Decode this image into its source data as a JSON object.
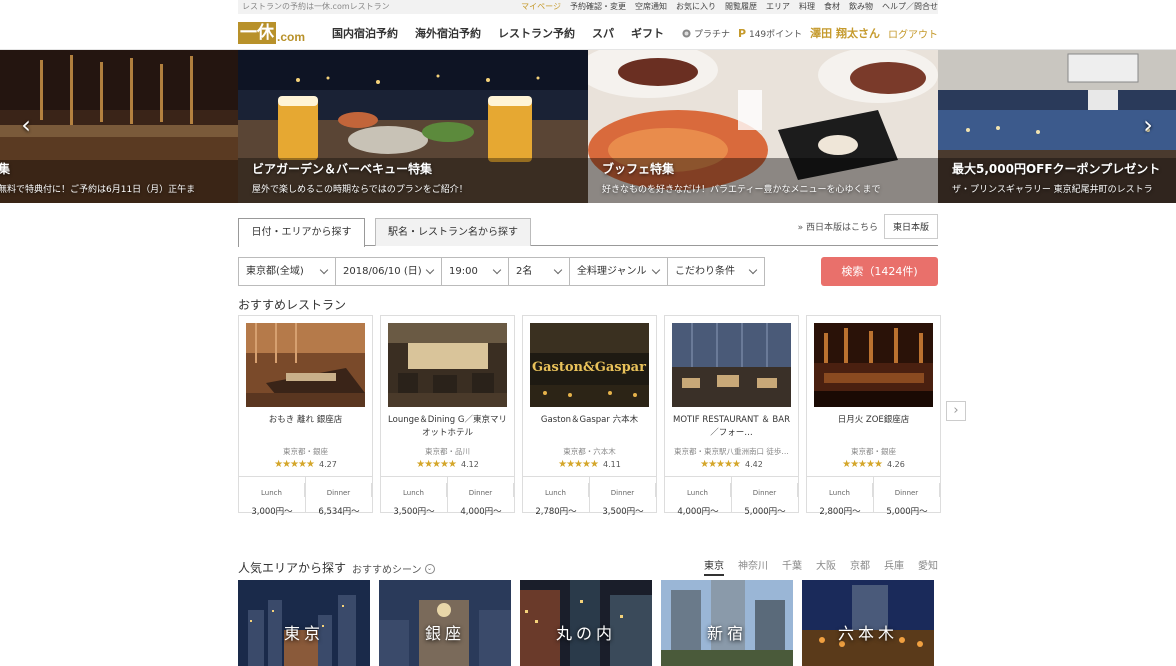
{
  "topbar": {
    "tagline": "レストランの予約は一休.comレストラン",
    "links": [
      "マイページ",
      "予約確認・変更",
      "空席通知",
      "お気に入り",
      "閲覧履歴",
      "エリア",
      "料理",
      "食材",
      "飲み物",
      "ヘルプ／問合せ"
    ]
  },
  "header": {
    "logo_mark": "一休",
    "logo_suffix": ".com",
    "nav": [
      "国内宿泊予約",
      "海外宿泊予約",
      "レストラン予約",
      "スパ",
      "ギフト"
    ],
    "rank": "プラチナ",
    "points_prefix": "P",
    "points": "149ポイント",
    "user": "澤田 翔太さん",
    "logout": "ログアウト"
  },
  "hero": {
    "slides": [
      {
        "title": "集",
        "subtitle": "無料で特典付に！ご予約は6月11日（月）正午ま"
      },
      {
        "title": "ビアガーデン＆バーベキュー特集",
        "subtitle": "屋外で楽しめるこの時期ならではのプランをご紹介！"
      },
      {
        "title": "ブッフェ特集",
        "subtitle": "好きなものを好きなだけ！バラエティー豊かなメニューを心ゆくまで"
      },
      {
        "title": "最大5,000円OFFクーポンプレゼント",
        "subtitle": "ザ・プリンスギャラリー 東京紀尾井町のレストラ"
      }
    ],
    "prev": "‹",
    "next": "›"
  },
  "search": {
    "tabs": [
      "日付・エリアから探す",
      "駅名・レストラン名から探す"
    ],
    "west_link": "» 西日本版はこちら",
    "east_button": "東日本版",
    "filters": {
      "area": "東京都(全域)",
      "date": "2018/06/10 (日)",
      "time": "19:00",
      "people": "2名",
      "genre": "全料理ジャンル",
      "preferences": "こだわり条件"
    },
    "button": "検索（1424件)"
  },
  "recommend": {
    "title": "おすすめレストラン",
    "lunch_label": "Lunch",
    "dinner_label": "Dinner",
    "stars": "★★★★★",
    "next": "›",
    "items": [
      {
        "name": "おもき 離れ 銀座店",
        "area": "東京都・銀座",
        "rating": "4.27",
        "lunch": "3,000円〜",
        "dinner": "6,534円〜"
      },
      {
        "name": "Lounge＆Dining G／東京マリオットホテル",
        "area": "東京都・品川",
        "rating": "4.12",
        "lunch": "3,500円〜",
        "dinner": "4,000円〜"
      },
      {
        "name": "Gaston＆Gaspar 六本木",
        "area": "東京都・六本木",
        "rating": "4.11",
        "lunch": "2,780円〜",
        "dinner": "3,500円〜"
      },
      {
        "name": "MOTIF RESTAURANT ＆ BAR／フォー…",
        "area": "東京都・東京駅八重洲南口 徒歩…",
        "rating": "4.42",
        "lunch": "4,000円〜",
        "dinner": "5,000円〜"
      },
      {
        "name": "日月火 ZOE銀座店",
        "area": "東京都・銀座",
        "rating": "4.26",
        "lunch": "2,800円〜",
        "dinner": "5,000円〜"
      }
    ],
    "sign_text": "Gaston&Gaspar"
  },
  "popular": {
    "title": "人気エリアから探す",
    "scene": "おすすめシーン",
    "scene_icon": "⌄",
    "prefectures": [
      "東京",
      "神奈川",
      "千葉",
      "大阪",
      "京都",
      "兵庫",
      "愛知"
    ],
    "areas": [
      "東京",
      "銀座",
      "丸の内",
      "新宿",
      "六本木"
    ]
  },
  "colors": {
    "brand_gold": "#b8912a",
    "search_red": "#e9706b"
  }
}
